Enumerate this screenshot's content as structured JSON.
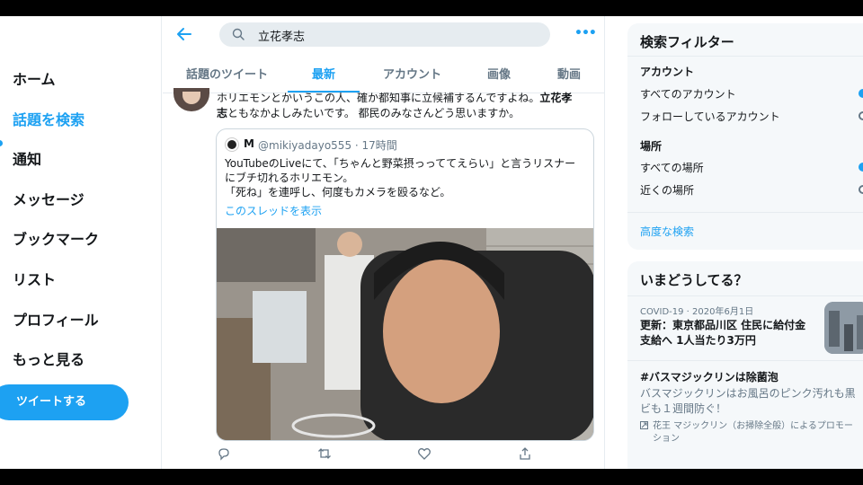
{
  "nav": {
    "items": [
      {
        "label": "ホーム",
        "active": false
      },
      {
        "label": "話題を検索",
        "active": true
      },
      {
        "label": "通知",
        "active": false
      },
      {
        "label": "メッセージ",
        "active": false
      },
      {
        "label": "ブックマーク",
        "active": false
      },
      {
        "label": "リスト",
        "active": false
      },
      {
        "label": "プロフィール",
        "active": false
      },
      {
        "label": "もっと見る",
        "active": false
      }
    ],
    "tweet_button": "ツイートする"
  },
  "header": {
    "search_value": "立花孝志",
    "more_icon": "more-icon"
  },
  "tabs": [
    "話題のツイート",
    "最新",
    "アカウント",
    "画像",
    "動画"
  ],
  "active_tab": "最新",
  "tweet": {
    "text_line1_start": "ホリエモンとかいうこの人、確か都知事に立候補するんですよね。",
    "text_line1_bold": "立花孝",
    "text_line2_bold": "志",
    "text_line2_rest": "ともなかよしみたいです。 都民のみなさんどう思いますか。",
    "quote": {
      "name": "M",
      "handle_time": "@mikiyadayo555 · 17時間",
      "body_line1": "YouTubeのLiveにて、「ちゃんと野菜摂っっててえらい」と言うリスナー",
      "body_line2": "にブチ切れるホリエモン。",
      "body_line3": "「死ね」を連呼し、何度もカメラを殴るなど。",
      "thread_link": "このスレッドを表示"
    },
    "actions": [
      "reply-icon",
      "retweet-icon",
      "like-icon",
      "share-icon"
    ]
  },
  "filters": {
    "title": "検索フィルター",
    "account_heading": "アカウント",
    "account_options": [
      "すべてのアカウント",
      "フォローしているアカウント"
    ],
    "place_heading": "場所",
    "place_options": [
      "すべての場所",
      "近くの場所"
    ],
    "advanced_link": "高度な検索"
  },
  "trends": {
    "title": "いまどうしてる？",
    "items": [
      {
        "meta": "COVID-19 · 2020年6月1日",
        "title_line1": "更新：東京都品川区 住民に給付金",
        "title_line2": "支給へ 1人当たり3万円"
      },
      {
        "title_line1": "#バスマジックリンは除菌泡",
        "desc_line1": "バスマジックリンはお風呂のピンク汚れも黒",
        "desc_line2": "ビも１週間防ぐ！",
        "promo_line1": "花王 マジックリン（お掃除全般）によるプロモー",
        "promo_line2": "ション"
      }
    ]
  },
  "colors": {
    "accent": "#1da1f2",
    "text": "#14171a",
    "secondary": "#657786",
    "border": "#e6ecf0"
  }
}
